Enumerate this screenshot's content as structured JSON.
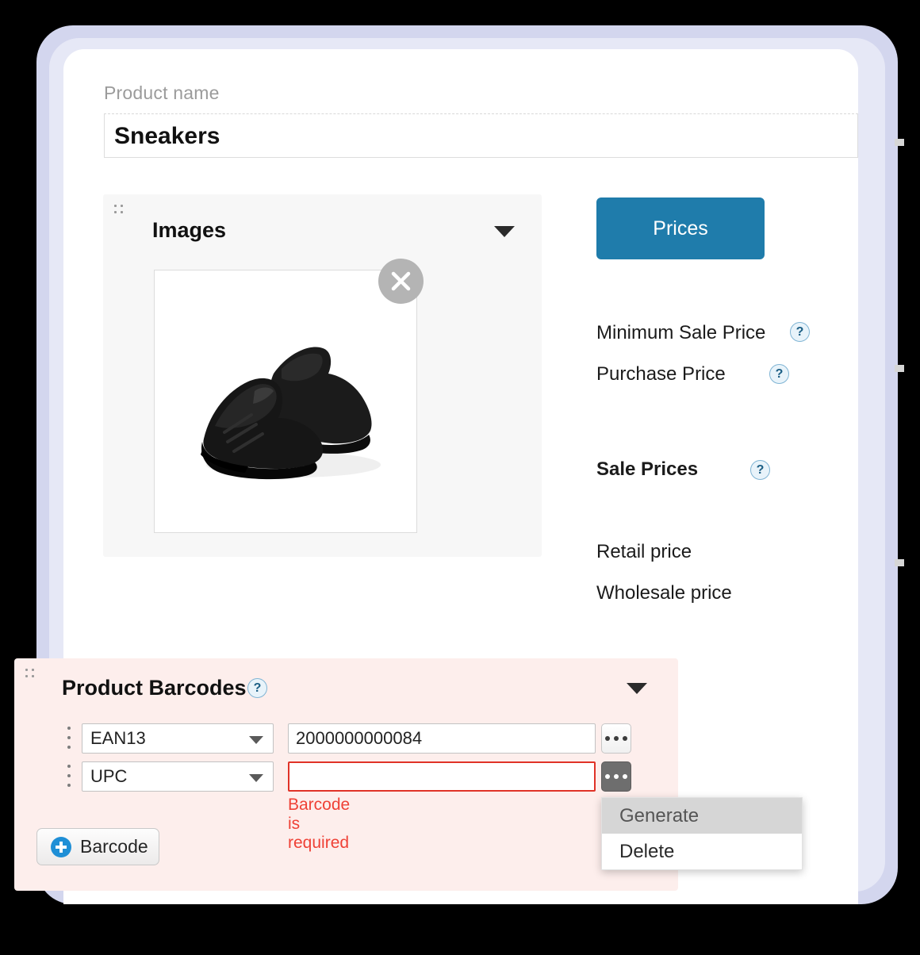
{
  "product": {
    "name_label": "Product name",
    "name_value": "Sneakers"
  },
  "images_panel": {
    "title": "Images",
    "drag_handle": "drag-handle-icon",
    "collapse_icon": "chevron-down-icon",
    "close_icon": "close-icon",
    "thumbnail_alt": "black sneakers pair"
  },
  "prices": {
    "button_label": "Prices",
    "minimum_sale_price_label": "Minimum Sale Price",
    "purchase_price_label": "Purchase Price",
    "sale_prices_label": "Sale Prices",
    "retail_price_label": "Retail price",
    "wholesale_price_label": "Wholesale price",
    "help_glyph": "?"
  },
  "barcodes": {
    "title": "Product Barcodes",
    "help_glyph": "?",
    "collapse_icon": "chevron-down-icon",
    "rows": [
      {
        "type": "EAN13",
        "value": "2000000000084",
        "error": "",
        "menu_active": false
      },
      {
        "type": "UPC",
        "value": "",
        "error": "Barcode is required",
        "menu_active": true
      }
    ],
    "add_button_label": "Barcode",
    "add_button_icon": "plus-circle-icon"
  },
  "context_menu": {
    "items": [
      {
        "label": "Generate",
        "highlighted": true
      },
      {
        "label": "Delete",
        "highlighted": false
      }
    ]
  },
  "colors": {
    "accent_blue": "#1f7cab",
    "error_red": "#ef4136",
    "panel_pink": "#fdeeec",
    "panel_gray": "#f7f7f7",
    "glow_lavender": "#d3d6ee"
  }
}
